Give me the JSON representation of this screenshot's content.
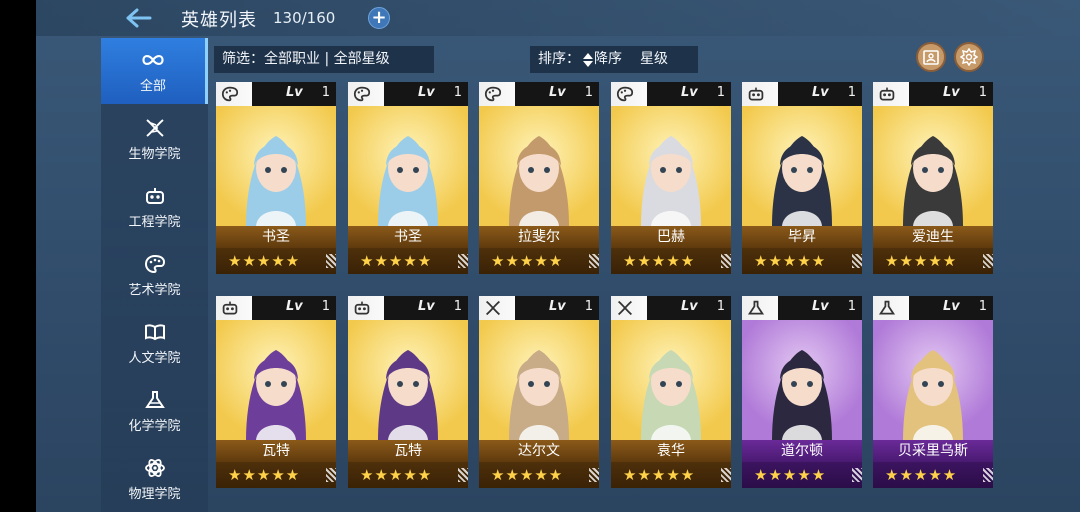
{
  "header": {
    "title": "英雄列表",
    "count": "130/160",
    "add_label": "+"
  },
  "sidebar": {
    "items": [
      {
        "label": "全部",
        "icon": "infinity-icon",
        "active": true
      },
      {
        "label": "生物学院",
        "icon": "dna-icon",
        "active": false
      },
      {
        "label": "工程学院",
        "icon": "robot-icon",
        "active": false
      },
      {
        "label": "艺术学院",
        "icon": "palette-icon",
        "active": false
      },
      {
        "label": "人文学院",
        "icon": "book-icon",
        "active": false
      },
      {
        "label": "化学学院",
        "icon": "flask-icon",
        "active": false
      },
      {
        "label": "物理学院",
        "icon": "atom-icon",
        "active": false
      }
    ]
  },
  "filter": {
    "label": "筛选：全部职业 | 全部星级"
  },
  "sort": {
    "label": "排序：",
    "order": "降序",
    "key": "星级"
  },
  "heroes": [
    {
      "name": "书圣",
      "lv_label": "Lv",
      "level": "1",
      "stars": "★★★★★",
      "class_icon": "palette-icon",
      "rarity": "gold",
      "color": "#9ccde8"
    },
    {
      "name": "书圣",
      "lv_label": "Lv",
      "level": "1",
      "stars": "★★★★★",
      "class_icon": "palette-icon",
      "rarity": "gold",
      "color": "#9ccde8"
    },
    {
      "name": "拉斐尔",
      "lv_label": "Lv",
      "level": "1",
      "stars": "★★★★★",
      "class_icon": "palette-icon",
      "rarity": "gold",
      "color": "#c39a6b"
    },
    {
      "name": "巴赫",
      "lv_label": "Lv",
      "level": "1",
      "stars": "★★★★★",
      "class_icon": "palette-icon",
      "rarity": "gold",
      "color": "#d9dbe0"
    },
    {
      "name": "毕昇",
      "lv_label": "Lv",
      "level": "1",
      "stars": "★★★★★",
      "class_icon": "robot-icon",
      "rarity": "gold",
      "color": "#2c3346"
    },
    {
      "name": "爱迪生",
      "lv_label": "Lv",
      "level": "1",
      "stars": "★★★★★",
      "class_icon": "robot-icon",
      "rarity": "gold",
      "color": "#3a3a3a"
    },
    {
      "name": "瓦特",
      "lv_label": "Lv",
      "level": "1",
      "stars": "★★★★★",
      "class_icon": "robot-icon",
      "rarity": "gold",
      "color": "#6d3f9a"
    },
    {
      "name": "瓦特",
      "lv_label": "Lv",
      "level": "1",
      "stars": "★★★★★",
      "class_icon": "robot-icon",
      "rarity": "gold",
      "color": "#5e3a86"
    },
    {
      "name": "达尔文",
      "lv_label": "Lv",
      "level": "1",
      "stars": "★★★★★",
      "class_icon": "dna-icon",
      "rarity": "gold",
      "color": "#c8ab87"
    },
    {
      "name": "袁华",
      "lv_label": "Lv",
      "level": "1",
      "stars": "★★★★★",
      "class_icon": "dna-icon",
      "rarity": "gold",
      "color": "#c6d9b4"
    },
    {
      "name": "道尔顿",
      "lv_label": "Lv",
      "level": "1",
      "stars": "★★★★★",
      "class_icon": "flask-icon",
      "rarity": "purple",
      "color": "#2c2840"
    },
    {
      "name": "贝采里乌斯",
      "lv_label": "Lv",
      "level": "1",
      "stars": "★★★★★",
      "class_icon": "flask-icon",
      "rarity": "purple",
      "color": "#e2c27c"
    }
  ],
  "colors": {
    "accent": "#2f7fe0",
    "gold_bg": "#f2c94c",
    "purple_bg": "#b07ad8",
    "star": "#ffd24a"
  }
}
